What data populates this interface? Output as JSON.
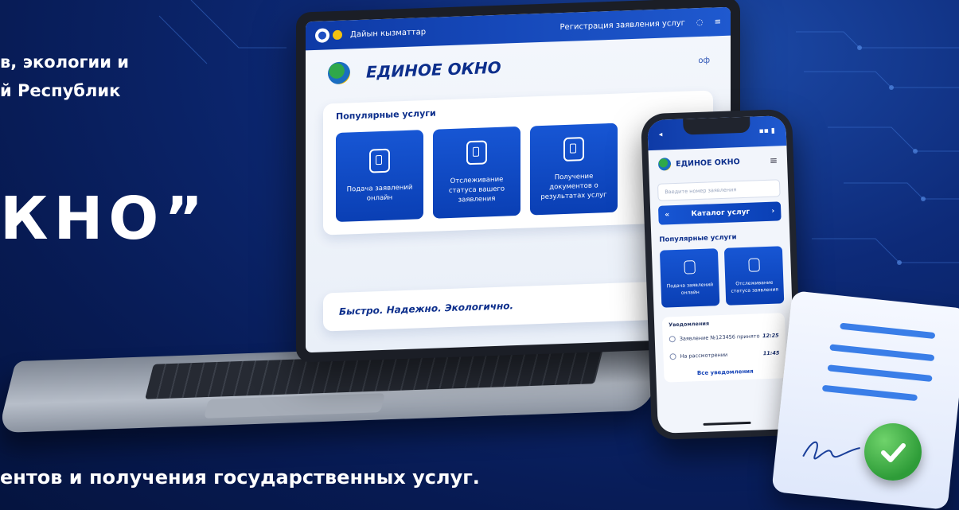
{
  "promo": {
    "org_line1": "в, экологии и",
    "org_line2": "й Республик",
    "headline": "КНО”",
    "subline": "ентов и получения государственных услуг."
  },
  "laptop": {
    "topbar_label": "Дайын кызматтар",
    "topbar_right": "Регистрация заявления услуг",
    "title": "ЕДИНОЕ ОКНО",
    "header_right": "оф",
    "popular_title": "Популярные услуги",
    "cards": [
      {
        "label": "Подача заявлений онлайн",
        "icon": "document-lock-icon"
      },
      {
        "label": "Отслеживание статуса вашего заявления",
        "icon": "status-shield-icon"
      },
      {
        "label": "Получение документов о результатах услуг",
        "icon": "document-stamp-icon"
      }
    ],
    "footer_slogan": "Быстро. Надежно. Экологично."
  },
  "phone": {
    "title": "ЕДИНОЕ ОКНО",
    "search_placeholder": "Введите номер заявления",
    "catalog_button": "Каталог услуг",
    "popular_title": "Популярные услуги",
    "cards": [
      {
        "label": "Подача заявлений онлайн"
      },
      {
        "label": "Отслеживание статуса заявления"
      }
    ],
    "notifications_title": "Уведомления",
    "notifications": [
      {
        "text": "Заявление №123456 принято",
        "time": "12:25"
      },
      {
        "text": "На рассмотрении",
        "time": "11:45"
      }
    ],
    "notifications_all": "Все уведомления"
  },
  "colors": {
    "brand_blue": "#0e3aa6",
    "accent_blue": "#1756d4",
    "check_green": "#2e9c38"
  }
}
